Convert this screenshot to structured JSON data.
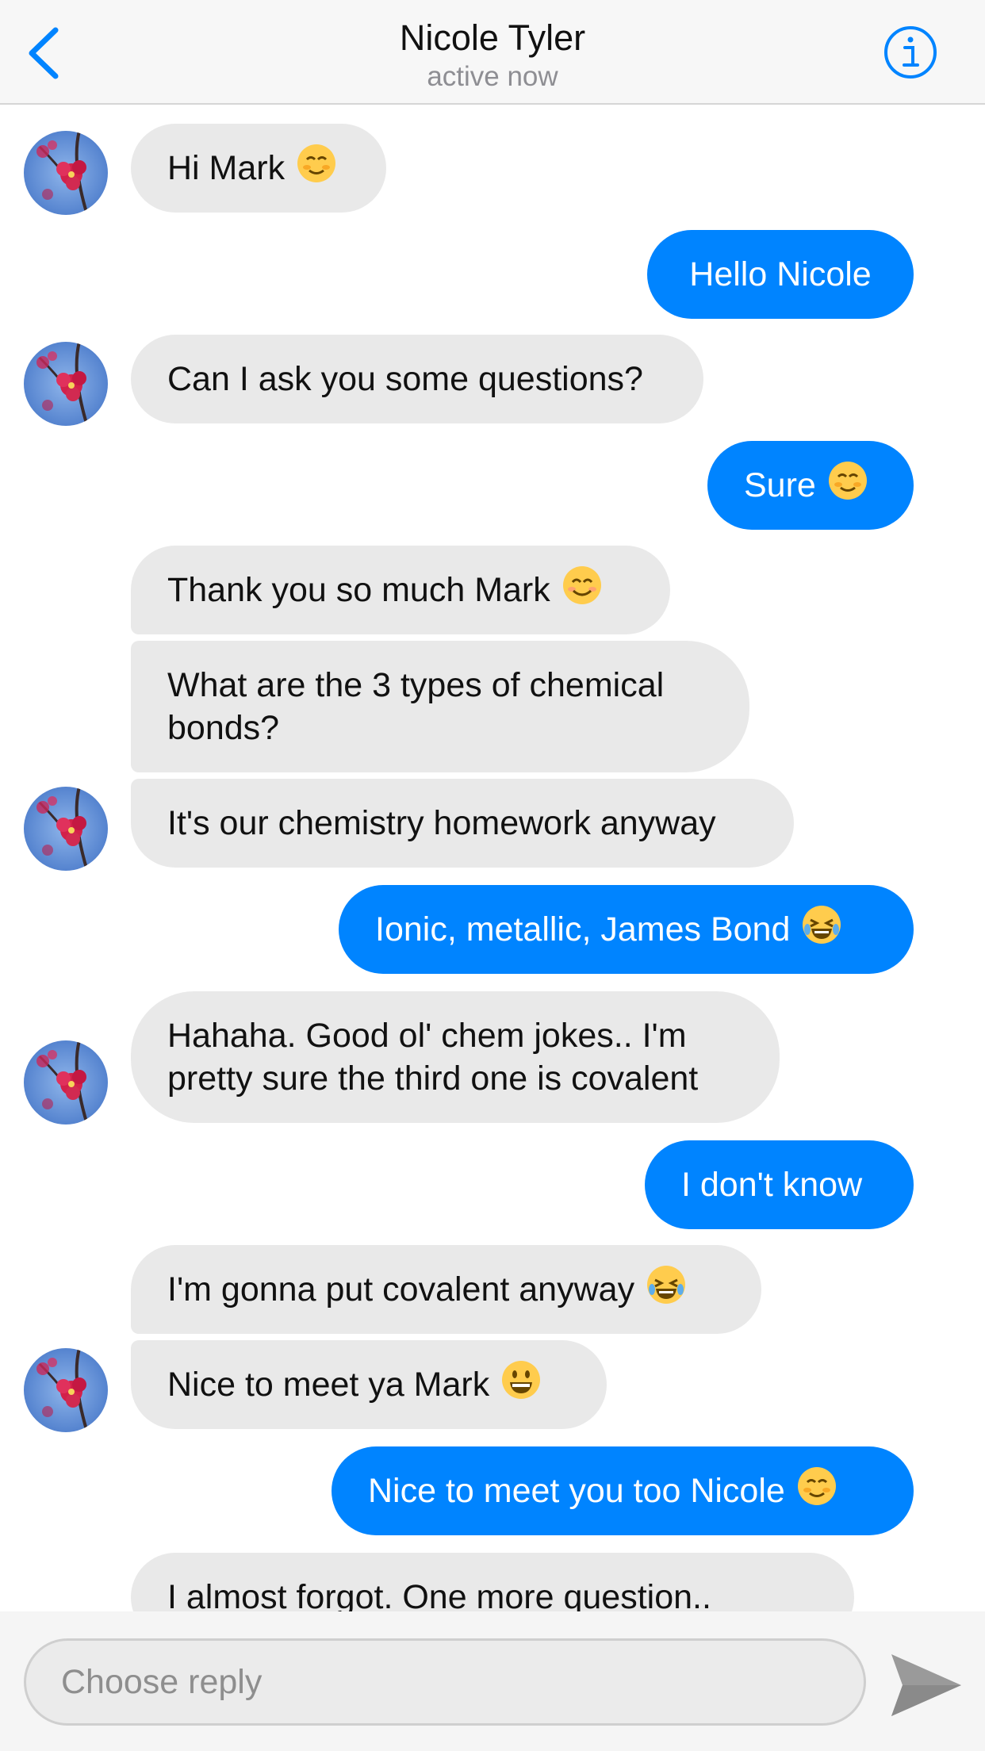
{
  "header": {
    "name": "Nicole Tyler",
    "status": "active now",
    "accent": "#0084ff"
  },
  "messages": [
    {
      "from": "them",
      "text": "Hi Mark",
      "emoji": "blush"
    },
    {
      "from": "me",
      "text": "Hello Nicole"
    },
    {
      "from": "them",
      "text": "Can I ask you some questions?"
    },
    {
      "from": "me",
      "text": "Sure",
      "emoji": "blush"
    },
    {
      "from": "them",
      "text": "Thank you so much Mark",
      "emoji": "smile"
    },
    {
      "from": "them",
      "text": "What are the 3 types of chemical bonds?"
    },
    {
      "from": "them",
      "text": "It's our chemistry homework anyway"
    },
    {
      "from": "me",
      "text": "Ionic, metallic, James Bond",
      "emoji": "joy"
    },
    {
      "from": "them",
      "text": "Hahaha. Good ol' chem jokes.. I'm pretty sure the third one is covalent"
    },
    {
      "from": "me",
      "text": "I don't know"
    },
    {
      "from": "them",
      "text": "I'm gonna put covalent anyway",
      "emoji": "joy"
    },
    {
      "from": "them",
      "text": "Nice to meet ya Mark",
      "emoji": "grin"
    },
    {
      "from": "me",
      "text": "Nice to meet you too Nicole",
      "emoji": "blush"
    },
    {
      "from": "them",
      "text": "I almost forgot. One more question.."
    }
  ],
  "composer": {
    "placeholder": "Choose reply"
  },
  "colors": {
    "incoming_bubble": "#e9e9e9",
    "outgoing_bubble": "#0084ff",
    "header_bg": "#f7f7f7"
  },
  "icons": {
    "back": "chevron-left-icon",
    "info": "info-circle-icon",
    "send": "paper-plane-icon"
  }
}
